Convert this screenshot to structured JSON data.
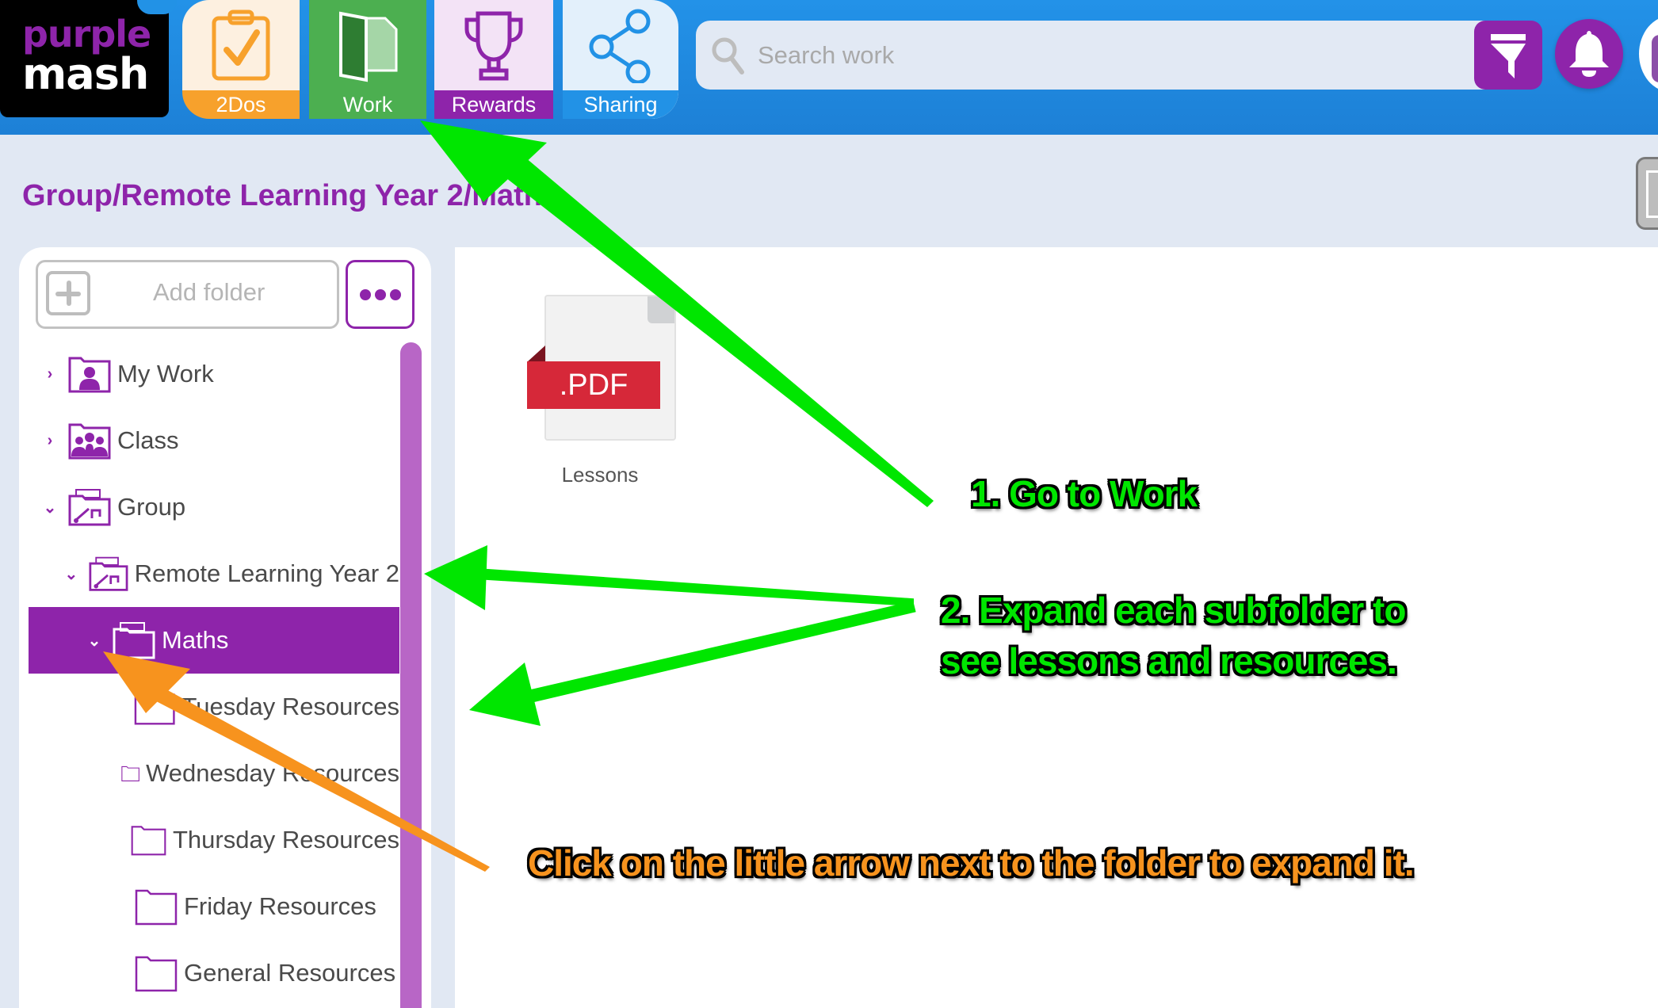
{
  "header": {
    "logo": {
      "line1": "purple",
      "line2": "mash"
    },
    "tabs": [
      {
        "id": "2dos",
        "label": "2Dos",
        "icon": "clipboard-check-icon"
      },
      {
        "id": "work",
        "label": "Work",
        "icon": "folder-document-icon"
      },
      {
        "id": "rewards",
        "label": "Rewards",
        "icon": "trophy-icon"
      },
      {
        "id": "sharing",
        "label": "Sharing",
        "icon": "share-icon"
      }
    ],
    "search": {
      "placeholder": "Search work",
      "value": ""
    },
    "filter_icon": "filter-icon",
    "notifications_icon": "bell-icon"
  },
  "breadcrumb": "Group/Remote Learning Year 2/Maths",
  "sidebar": {
    "add_folder_label": "Add folder",
    "more_icon": "ellipsis-icon",
    "tree": [
      {
        "label": "My Work",
        "level": 0,
        "expander": "chevron-right",
        "icon": "user-folder-icon"
      },
      {
        "label": "Class",
        "level": 0,
        "expander": "chevron-right",
        "icon": "class-folder-icon"
      },
      {
        "label": "Group",
        "level": 0,
        "expander": "chevron-down",
        "icon": "group-folder-icon"
      },
      {
        "label": "Remote Learning Year 2",
        "level": 1,
        "expander": "chevron-down",
        "icon": "group-folder-icon"
      },
      {
        "label": "Maths",
        "level": 2,
        "expander": "chevron-down",
        "icon": "group-folder-icon",
        "selected": true
      },
      {
        "label": "Tuesday Resources",
        "level": 3,
        "expander": "",
        "icon": "folder-icon"
      },
      {
        "label": "Wednesday Resources",
        "level": 3,
        "expander": "",
        "icon": "folder-icon"
      },
      {
        "label": "Thursday Resources",
        "level": 3,
        "expander": "",
        "icon": "folder-icon"
      },
      {
        "label": "Friday Resources",
        "level": 3,
        "expander": "",
        "icon": "folder-icon"
      },
      {
        "label": "General Resources",
        "level": 3,
        "expander": "",
        "icon": "folder-icon"
      }
    ]
  },
  "main": {
    "files": [
      {
        "name": "Lessons",
        "type_badge": ".PDF"
      }
    ]
  },
  "annotations": {
    "step1": "1. Go to Work",
    "step2": "2. Expand each subfolder to see lessons and resources.",
    "tip": "Click on the little arrow next to the folder to expand it."
  },
  "colors": {
    "brand_purple": "#8e24aa",
    "header_blue": "#2292e6",
    "work_green": "#4caf50",
    "todo_orange": "#f7a12c",
    "annotation_green": "#00e600",
    "annotation_orange": "#f7931e"
  }
}
